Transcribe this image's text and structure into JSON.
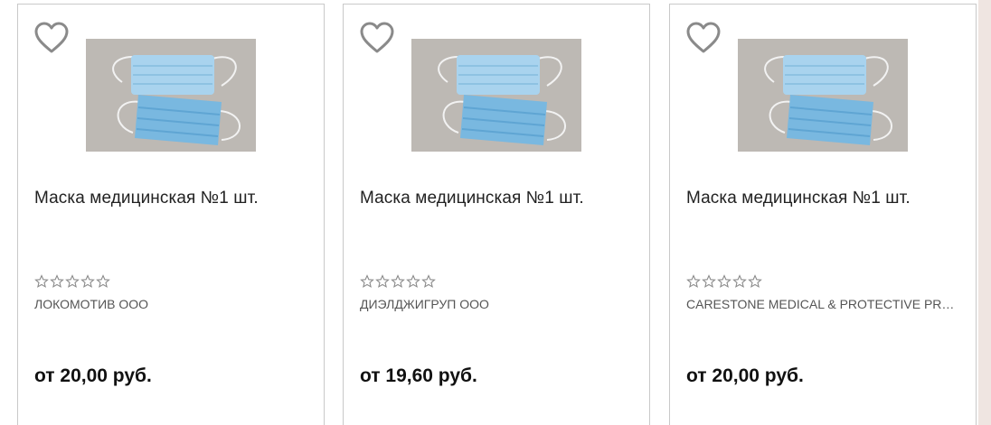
{
  "products": [
    {
      "title": "Маска медицинская №1 шт.",
      "seller": "ЛОКОМОТИВ ООО",
      "price": "от 20,00 руб.",
      "rating": 0,
      "rating_max": 5,
      "favorite_icon": "heart-outline-icon"
    },
    {
      "title": "Маска медицинская №1 шт.",
      "seller": "ДИЭЛДЖИГРУП ООО",
      "price": "от 19,60 руб.",
      "rating": 0,
      "rating_max": 5,
      "favorite_icon": "heart-outline-icon"
    },
    {
      "title": "Маска медицинская №1 шт.",
      "seller": "CARESTONE MEDICAL & PROTECTIVE PRO...",
      "price": "от 20,00 руб.",
      "rating": 0,
      "rating_max": 5,
      "favorite_icon": "heart-outline-icon"
    }
  ],
  "colors": {
    "card_border": "#c9c9c9",
    "heart": "#8a8a8a",
    "star_outline": "#8a8a8a",
    "mask_blue": "#8fc3e3",
    "photo_background": "#b7b3ae",
    "side_strip": "#efe5e1"
  }
}
